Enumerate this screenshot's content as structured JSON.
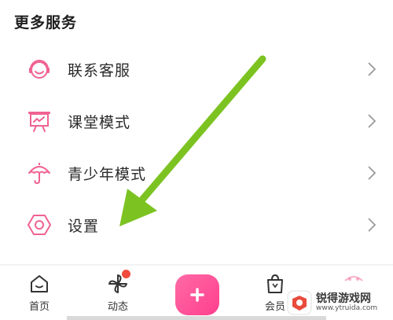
{
  "section": {
    "title": "更多服务"
  },
  "menu": {
    "items": [
      {
        "label": "联系客服",
        "icon": "headset-icon"
      },
      {
        "label": "课堂模式",
        "icon": "classroom-board-icon"
      },
      {
        "label": "青少年模式",
        "icon": "umbrella-icon"
      },
      {
        "label": "设置",
        "icon": "hexagon-settings-icon"
      }
    ]
  },
  "tabbar": {
    "tabs": [
      {
        "label": "首页",
        "icon": "home-icon"
      },
      {
        "label": "动态",
        "icon": "pinwheel-icon",
        "badge": true
      },
      {
        "label": "",
        "icon": "plus-icon"
      },
      {
        "label": "会员",
        "icon": "shopping-bag-icon"
      },
      {
        "label": "",
        "icon": "profile-icon"
      }
    ]
  },
  "watermark": {
    "name": "锐得游戏网",
    "url": "www.ytruida.com"
  },
  "colors": {
    "accent_pink": "#f06292",
    "plus_gradient_start": "#ff6aa5",
    "plus_gradient_end": "#ff3f8e",
    "arrow_green": "#7cc321",
    "badge_red": "#f04b3c",
    "chevron_gray": "#9a9a9a"
  }
}
